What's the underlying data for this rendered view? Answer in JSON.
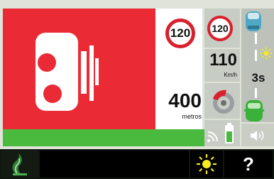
{
  "speed_camera_alert": {
    "speed_limit_sign": "120",
    "distance_value": "400",
    "distance_unit": "metros"
  },
  "sidebar": {
    "speed_limit_sign": "120",
    "current_speed": "110",
    "speed_unit": "Km/h"
  },
  "road": {
    "time_gap": "3s"
  },
  "bottom_bar": {
    "help_label": "?"
  },
  "colors": {
    "alert_red": "#ea2a35",
    "status_green": "#4aba3e",
    "sign_red": "#d9202e",
    "sun_yellow": "#f5ea1f"
  }
}
